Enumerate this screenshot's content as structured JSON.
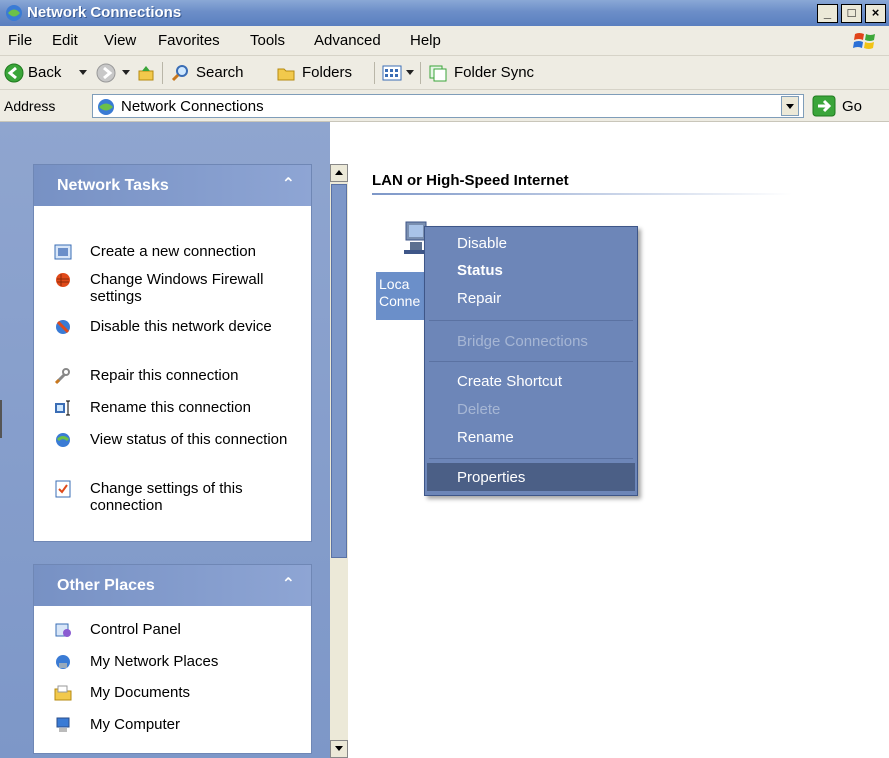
{
  "window": {
    "title": "Network Connections",
    "controls": {
      "minimize": "_",
      "maximize": "□",
      "close": "×"
    }
  },
  "menubar": {
    "items": [
      "File",
      "Edit",
      "View",
      "Favorites",
      "Tools",
      "Advanced",
      "Help"
    ]
  },
  "toolbar": {
    "back": "Back",
    "search": "Search",
    "folders": "Folders",
    "folder_sync": "Folder Sync"
  },
  "address": {
    "label": "Address",
    "value": "Network Connections",
    "go": "Go"
  },
  "network_tasks": {
    "title": "Network Tasks",
    "chevron": "⌃",
    "items": [
      {
        "label": "Create a new connection",
        "icon": "new-connection-icon"
      },
      {
        "label": "Change Windows Firewall settings",
        "icon": "firewall-icon"
      },
      {
        "label": "Disable this network device",
        "icon": "disable-device-icon"
      },
      {
        "label": "Repair this connection",
        "icon": "repair-icon"
      },
      {
        "label": "Rename this connection",
        "icon": "rename-icon"
      },
      {
        "label": "View status of this connection",
        "icon": "status-icon"
      },
      {
        "label": "Change settings of this connection",
        "icon": "settings-icon"
      }
    ]
  },
  "other_places": {
    "title": "Other Places",
    "chevron": "⌃",
    "items": [
      {
        "label": "Control Panel",
        "icon": "control-panel-icon"
      },
      {
        "label": "My Network Places",
        "icon": "network-places-icon"
      },
      {
        "label": "My Documents",
        "icon": "documents-icon"
      },
      {
        "label": "My Computer",
        "icon": "computer-icon"
      }
    ]
  },
  "content": {
    "group_header": "LAN or High-Speed Internet",
    "connection_label_line1": "Loca",
    "connection_label_line2": "Conne"
  },
  "context_menu": {
    "items": [
      {
        "label": "Disable",
        "state": "normal"
      },
      {
        "label": "Status",
        "state": "default"
      },
      {
        "label": "Repair",
        "state": "normal"
      },
      {
        "label": "Bridge Connections",
        "state": "disabled"
      },
      {
        "label": "Create Shortcut",
        "state": "normal"
      },
      {
        "label": "Delete",
        "state": "disabled"
      },
      {
        "label": "Rename",
        "state": "normal"
      },
      {
        "label": "Properties",
        "state": "highlighted"
      }
    ]
  },
  "colors": {
    "panel_blue": "#7d97c8",
    "menu_bg": "#6d86b8",
    "highlight": "#4b5f86",
    "chrome": "#eeece3"
  }
}
